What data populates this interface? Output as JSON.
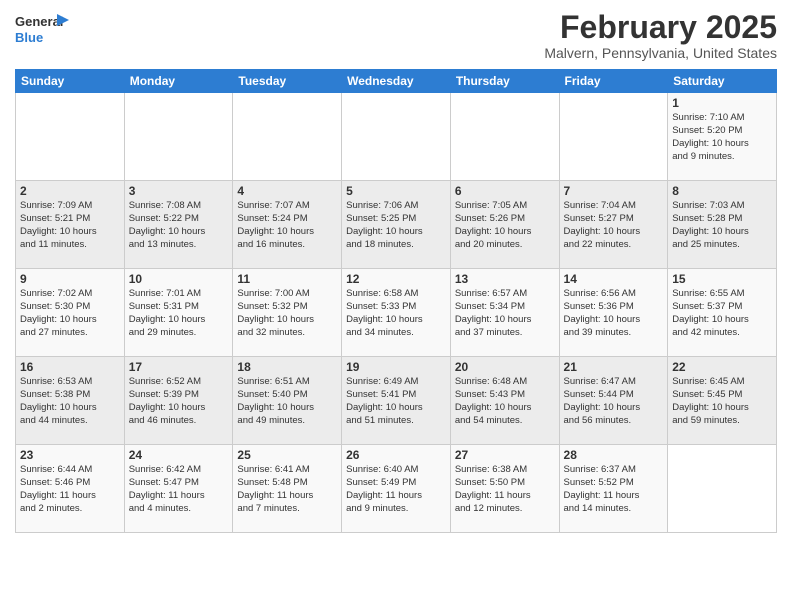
{
  "header": {
    "logo_general": "General",
    "logo_blue": "Blue",
    "month_year": "February 2025",
    "location": "Malvern, Pennsylvania, United States"
  },
  "days_of_week": [
    "Sunday",
    "Monday",
    "Tuesday",
    "Wednesday",
    "Thursday",
    "Friday",
    "Saturday"
  ],
  "weeks": [
    [
      {
        "day": "",
        "info": ""
      },
      {
        "day": "",
        "info": ""
      },
      {
        "day": "",
        "info": ""
      },
      {
        "day": "",
        "info": ""
      },
      {
        "day": "",
        "info": ""
      },
      {
        "day": "",
        "info": ""
      },
      {
        "day": "1",
        "info": "Sunrise: 7:10 AM\nSunset: 5:20 PM\nDaylight: 10 hours\nand 9 minutes."
      }
    ],
    [
      {
        "day": "2",
        "info": "Sunrise: 7:09 AM\nSunset: 5:21 PM\nDaylight: 10 hours\nand 11 minutes."
      },
      {
        "day": "3",
        "info": "Sunrise: 7:08 AM\nSunset: 5:22 PM\nDaylight: 10 hours\nand 13 minutes."
      },
      {
        "day": "4",
        "info": "Sunrise: 7:07 AM\nSunset: 5:24 PM\nDaylight: 10 hours\nand 16 minutes."
      },
      {
        "day": "5",
        "info": "Sunrise: 7:06 AM\nSunset: 5:25 PM\nDaylight: 10 hours\nand 18 minutes."
      },
      {
        "day": "6",
        "info": "Sunrise: 7:05 AM\nSunset: 5:26 PM\nDaylight: 10 hours\nand 20 minutes."
      },
      {
        "day": "7",
        "info": "Sunrise: 7:04 AM\nSunset: 5:27 PM\nDaylight: 10 hours\nand 22 minutes."
      },
      {
        "day": "8",
        "info": "Sunrise: 7:03 AM\nSunset: 5:28 PM\nDaylight: 10 hours\nand 25 minutes."
      }
    ],
    [
      {
        "day": "9",
        "info": "Sunrise: 7:02 AM\nSunset: 5:30 PM\nDaylight: 10 hours\nand 27 minutes."
      },
      {
        "day": "10",
        "info": "Sunrise: 7:01 AM\nSunset: 5:31 PM\nDaylight: 10 hours\nand 29 minutes."
      },
      {
        "day": "11",
        "info": "Sunrise: 7:00 AM\nSunset: 5:32 PM\nDaylight: 10 hours\nand 32 minutes."
      },
      {
        "day": "12",
        "info": "Sunrise: 6:58 AM\nSunset: 5:33 PM\nDaylight: 10 hours\nand 34 minutes."
      },
      {
        "day": "13",
        "info": "Sunrise: 6:57 AM\nSunset: 5:34 PM\nDaylight: 10 hours\nand 37 minutes."
      },
      {
        "day": "14",
        "info": "Sunrise: 6:56 AM\nSunset: 5:36 PM\nDaylight: 10 hours\nand 39 minutes."
      },
      {
        "day": "15",
        "info": "Sunrise: 6:55 AM\nSunset: 5:37 PM\nDaylight: 10 hours\nand 42 minutes."
      }
    ],
    [
      {
        "day": "16",
        "info": "Sunrise: 6:53 AM\nSunset: 5:38 PM\nDaylight: 10 hours\nand 44 minutes."
      },
      {
        "day": "17",
        "info": "Sunrise: 6:52 AM\nSunset: 5:39 PM\nDaylight: 10 hours\nand 46 minutes."
      },
      {
        "day": "18",
        "info": "Sunrise: 6:51 AM\nSunset: 5:40 PM\nDaylight: 10 hours\nand 49 minutes."
      },
      {
        "day": "19",
        "info": "Sunrise: 6:49 AM\nSunset: 5:41 PM\nDaylight: 10 hours\nand 51 minutes."
      },
      {
        "day": "20",
        "info": "Sunrise: 6:48 AM\nSunset: 5:43 PM\nDaylight: 10 hours\nand 54 minutes."
      },
      {
        "day": "21",
        "info": "Sunrise: 6:47 AM\nSunset: 5:44 PM\nDaylight: 10 hours\nand 56 minutes."
      },
      {
        "day": "22",
        "info": "Sunrise: 6:45 AM\nSunset: 5:45 PM\nDaylight: 10 hours\nand 59 minutes."
      }
    ],
    [
      {
        "day": "23",
        "info": "Sunrise: 6:44 AM\nSunset: 5:46 PM\nDaylight: 11 hours\nand 2 minutes."
      },
      {
        "day": "24",
        "info": "Sunrise: 6:42 AM\nSunset: 5:47 PM\nDaylight: 11 hours\nand 4 minutes."
      },
      {
        "day": "25",
        "info": "Sunrise: 6:41 AM\nSunset: 5:48 PM\nDaylight: 11 hours\nand 7 minutes."
      },
      {
        "day": "26",
        "info": "Sunrise: 6:40 AM\nSunset: 5:49 PM\nDaylight: 11 hours\nand 9 minutes."
      },
      {
        "day": "27",
        "info": "Sunrise: 6:38 AM\nSunset: 5:50 PM\nDaylight: 11 hours\nand 12 minutes."
      },
      {
        "day": "28",
        "info": "Sunrise: 6:37 AM\nSunset: 5:52 PM\nDaylight: 11 hours\nand 14 minutes."
      },
      {
        "day": "",
        "info": ""
      }
    ]
  ]
}
